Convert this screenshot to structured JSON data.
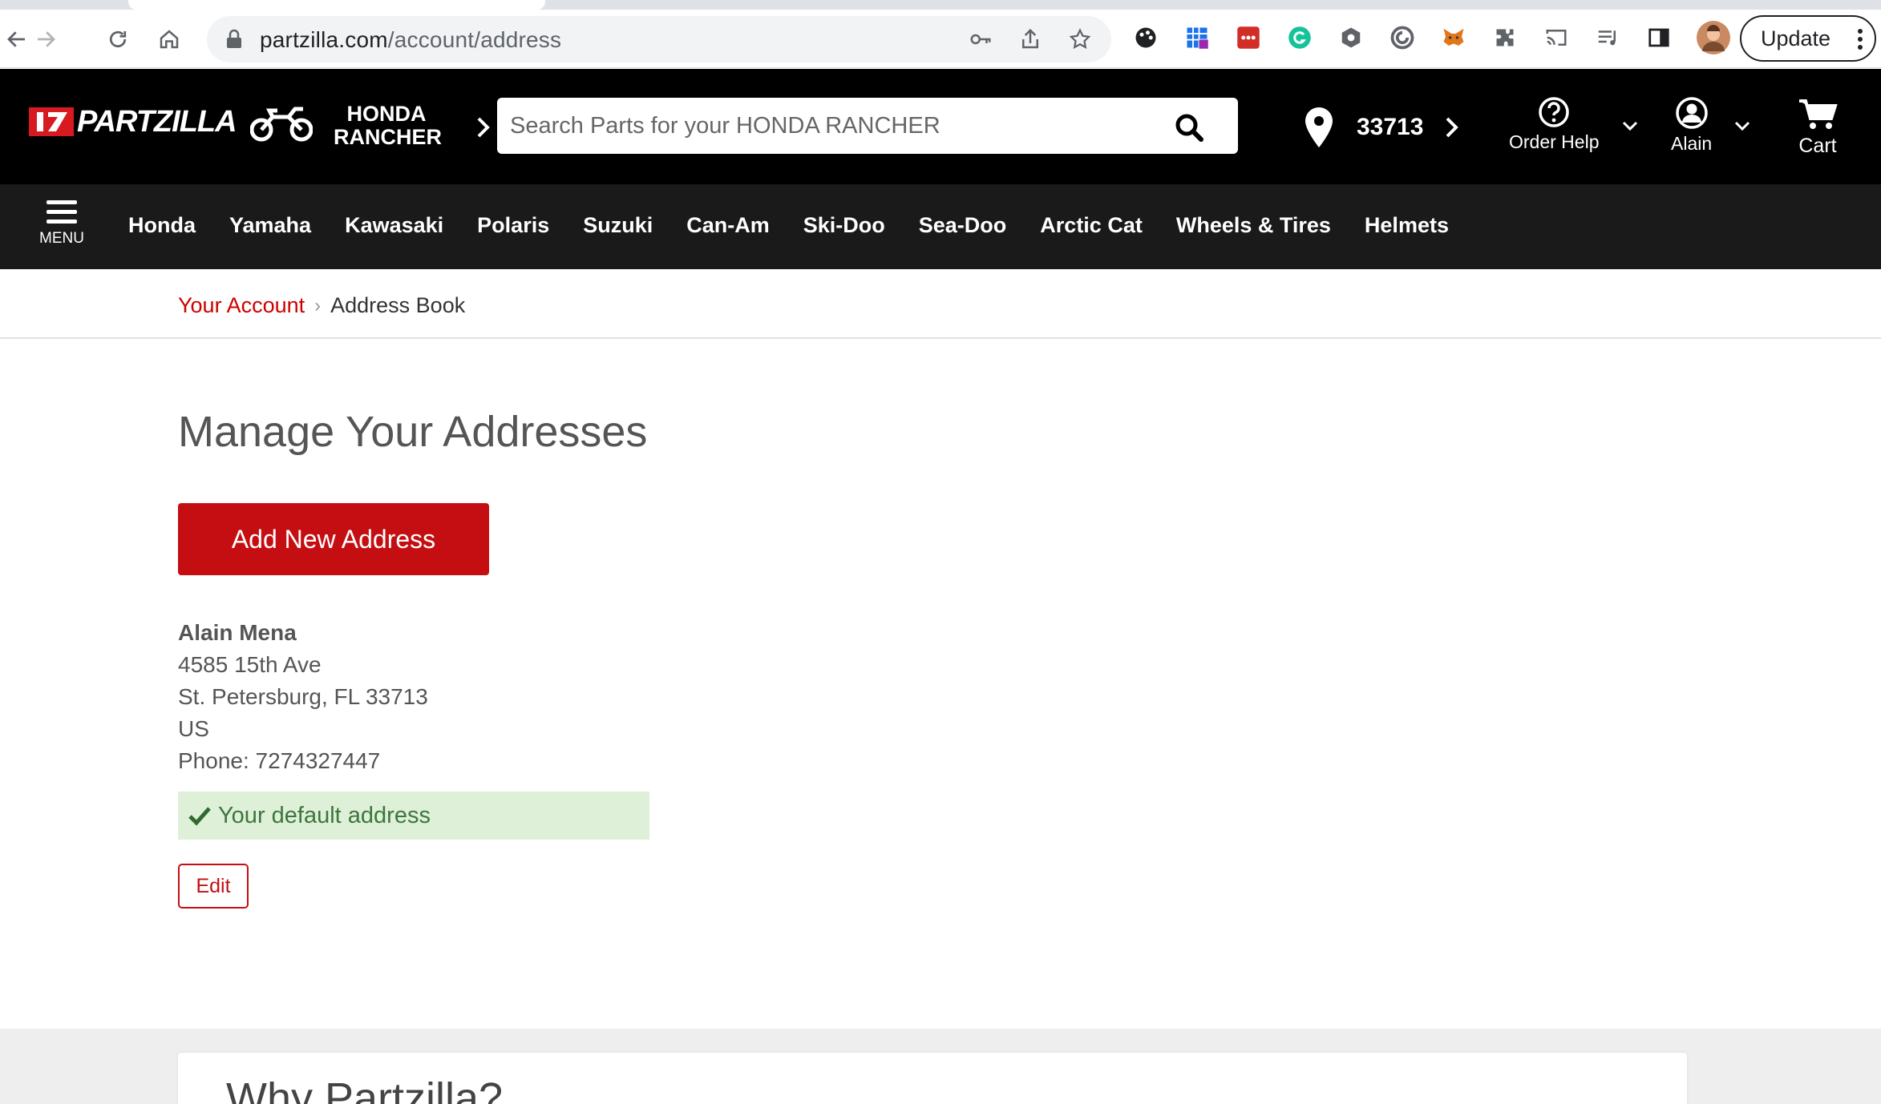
{
  "browser": {
    "url_domain": "partzilla.com",
    "url_path": "/account/address",
    "update_label": "Update"
  },
  "header": {
    "logo_text": "PARTZILLA",
    "vehicle_line1": "HONDA",
    "vehicle_line2": "RANCHER",
    "search_placeholder": "Search Parts for your HONDA RANCHER",
    "zip": "33713",
    "order_help": "Order Help",
    "account_name": "Alain",
    "cart": "Cart"
  },
  "nav": {
    "menu_label": "MENU",
    "categories": [
      "Honda",
      "Yamaha",
      "Kawasaki",
      "Polaris",
      "Suzuki",
      "Can-Am",
      "Ski-Doo",
      "Sea-Doo",
      "Arctic Cat",
      "Wheels & Tires",
      "Helmets"
    ]
  },
  "breadcrumb": {
    "parent": "Your Account",
    "current": "Address Book"
  },
  "main": {
    "title": "Manage Your Addresses",
    "add_button": "Add New Address",
    "address": {
      "name": "Alain Mena",
      "street": "4585 15th Ave",
      "city_line": "St. Petersburg, FL 33713",
      "country": "US",
      "phone": "Phone: 7274327447"
    },
    "default_label": "Your default address",
    "edit_button": "Edit"
  },
  "footer": {
    "why_title": "Why Partzilla?"
  },
  "colors": {
    "brand_red": "#c50e12",
    "header_black": "#000000",
    "nav_dark": "#1a1a1a",
    "success_bg": "#dff0d8",
    "success_text": "#3c763d"
  }
}
